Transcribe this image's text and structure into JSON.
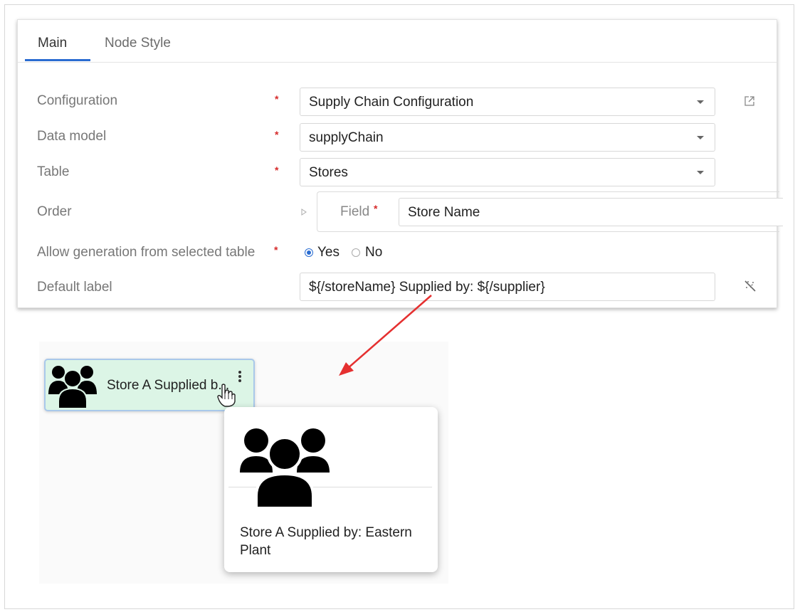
{
  "tabs": [
    {
      "label": "Main",
      "active": true
    },
    {
      "label": "Node Style",
      "active": false
    }
  ],
  "form": {
    "configuration": {
      "label": "Configuration",
      "value": "Supply Chain Configuration"
    },
    "data_model": {
      "label": "Data model",
      "value": "supplyChain"
    },
    "table": {
      "label": "Table",
      "value": "Stores"
    },
    "order": {
      "label": "Order",
      "field_label": "Field",
      "field_value": "Store Name"
    },
    "allow_generation": {
      "label": "Allow generation from selected table",
      "options": [
        "Yes",
        "No"
      ],
      "selected": "Yes"
    },
    "default_label": {
      "label": "Default label",
      "value": "${/storeName} Supplied by: ${/supplier}"
    }
  },
  "canvas": {
    "node_label": "Store A Supplied b...",
    "tooltip_text": "Store A Supplied by: Eastern Plant"
  },
  "icons": [
    "chevron-down-icon",
    "external-link-icon",
    "expand-triangle-icon",
    "wand-icon",
    "users-icon",
    "more-vertical-icon",
    "hand-cursor-icon",
    "arrow-icon"
  ],
  "colors": {
    "accent": "#2a6cd1",
    "required": "#d62a2a",
    "node_fill": "#dcf5e6",
    "arrow": "#e53030"
  }
}
